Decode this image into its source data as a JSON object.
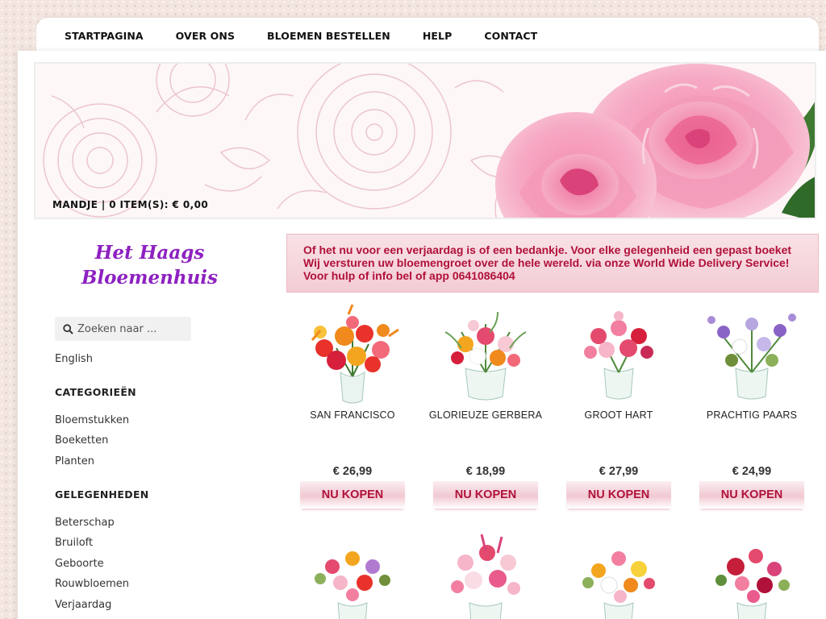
{
  "nav": {
    "items": [
      "STARTPAGINA",
      "OVER ONS",
      "BLOEMEN BESTELLEN",
      "HELP",
      "CONTACT"
    ]
  },
  "banner": {
    "cart": "MANDJE | 0 ITEM(S): € 0,00"
  },
  "logo": {
    "line1": "Het Haags",
    "line2": "Bloemenhuis"
  },
  "search": {
    "placeholder": "Zoeken naar ...",
    "icon": "search-icon"
  },
  "sidebar": {
    "language": "English",
    "categories_heading": "CATEGORIEËN",
    "categories": [
      "Bloemstukken",
      "Boeketten",
      "Planten"
    ],
    "occasions_heading": "GELEGENHEDEN",
    "occasions": [
      "Beterschap",
      "Bruiloft",
      "Geboorte",
      "Rouwbloemen",
      "Verjaardag"
    ]
  },
  "notice": {
    "text": "Of het nu voor een verjaardag is of een bedankje. Voor elke gelegenheid een gepast boeket Wij versturen uw bloemengroet over de hele wereld. via onze World Wide Delivery Service! Voor hulp of info bel of app 0641086404"
  },
  "products": [
    {
      "name": "SAN FRANCISCO",
      "price": "€ 26,99",
      "button": "NU KOPEN"
    },
    {
      "name": "GLORIEUZE GERBERA",
      "price": "€ 18,99",
      "button": "NU KOPEN"
    },
    {
      "name": "GROOT HART",
      "price": "€ 27,99",
      "button": "NU KOPEN"
    },
    {
      "name": "PRACHTIG PAARS",
      "price": "€ 24,99",
      "button": "NU KOPEN"
    }
  ],
  "colors": {
    "accent": "#b0113a",
    "logo": "#8d21c0",
    "notice_bg": "#f5d6dc"
  }
}
